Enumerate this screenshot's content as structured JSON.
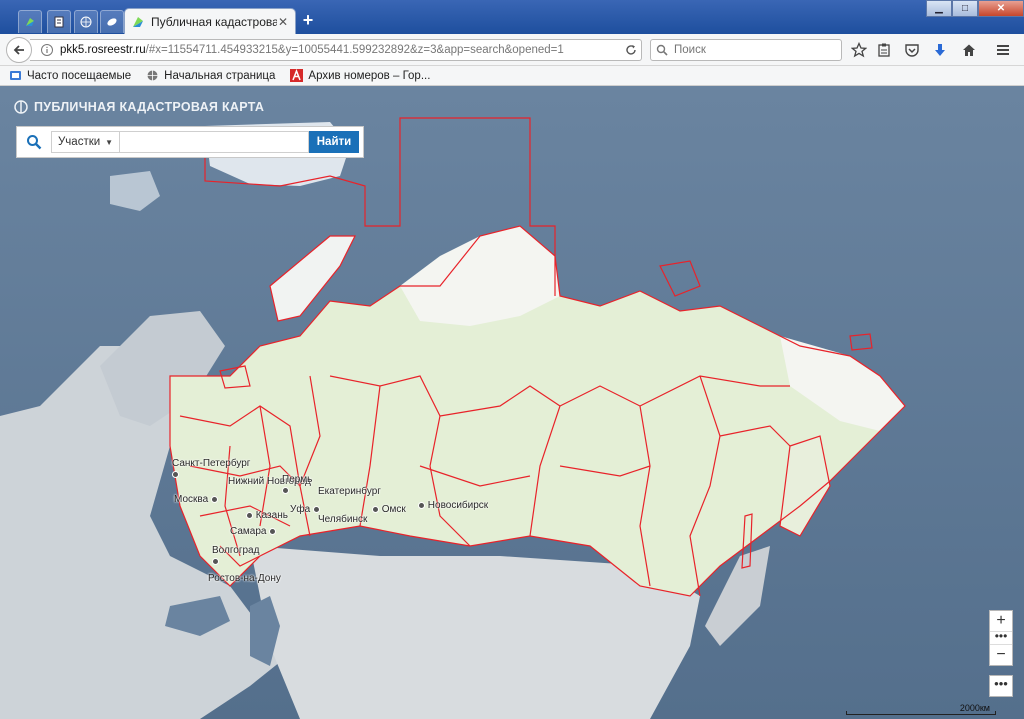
{
  "browser": {
    "active_tab_title": "Публичная кадастровая...",
    "url_host": "pkk5.rosreestr.ru",
    "url_rest": "/#x=11554711.454933215&y=10055441.599232892&z=3&app=search&opened=1",
    "search_placeholder": "Поиск"
  },
  "bookmarks": [
    {
      "label": "Часто посещаемые"
    },
    {
      "label": "Начальная страница"
    },
    {
      "label": "Архив номеров – Гор..."
    }
  ],
  "map": {
    "title": "ПУБЛИЧНАЯ КАДАСТРОВАЯ КАРТА",
    "search_type": "Участки",
    "search_button": "Найти",
    "scale_label": "2000км",
    "cities": [
      {
        "name": "Санкт-Петербург"
      },
      {
        "name": "Нижний Новгород"
      },
      {
        "name": "Москва"
      },
      {
        "name": "Казань"
      },
      {
        "name": "Самара"
      },
      {
        "name": "Пермь"
      },
      {
        "name": "Екатеринбург"
      },
      {
        "name": "Уфа"
      },
      {
        "name": "Челябинск"
      },
      {
        "name": "Омск"
      },
      {
        "name": "Новосибирск"
      },
      {
        "name": "Волгоград"
      },
      {
        "name": "Ростов-на-Дону"
      }
    ]
  },
  "colors": {
    "border_red": "#e8232a",
    "land_white": "#f4f5f1",
    "land_green": "#e4efd6",
    "sea": "#5c7894",
    "search_button": "#1a70b8"
  },
  "icons": {
    "search": "magnifier-icon",
    "zoom_in": "plus-icon",
    "zoom_out": "minus-icon",
    "more": "ellipsis-icon"
  }
}
